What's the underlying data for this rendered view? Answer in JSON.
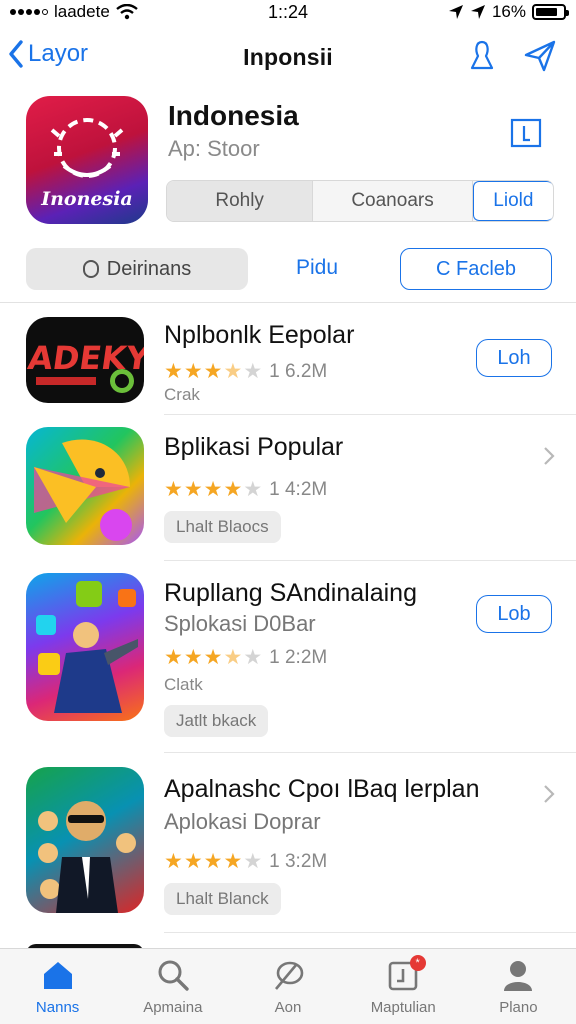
{
  "status_bar": {
    "carrier": "laadete",
    "time": "1::24",
    "battery": "16%",
    "battery_level": 0.8
  },
  "nav": {
    "back_label": "Layor",
    "title": "Inponsii",
    "icons": [
      "person-icon",
      "send-icon"
    ]
  },
  "app": {
    "name": "Indonesia",
    "subtitle": "Ap: Stoor",
    "icon_text": "Inonesia",
    "segments": [
      "Rohly",
      "Coanoars",
      "Liold"
    ],
    "accent_color": "#1a73e8"
  },
  "filters": {
    "pill_label": "Deirinans",
    "link_label": "Pidu",
    "button_label": "C Facleb"
  },
  "list": [
    {
      "title": "Nplbonlk Eepolar",
      "rating_text": "1 6.2M",
      "stars": 3.5,
      "small": "Crak",
      "button": "Loh",
      "icon_text": "ADEKY"
    },
    {
      "title": "Bplikasi Popular",
      "rating_text": "1 4:2M",
      "stars": 4,
      "tag": "Lhalt Blaocs"
    },
    {
      "title": "Rupllang SAndinalaing",
      "sub": "Splokasi D0Bar",
      "rating_text": "1 2:2M",
      "stars": 3.5,
      "small": "Clatk",
      "tag": "Jatlt bkack",
      "button": "Lob"
    },
    {
      "title": "Apalnashc Cpoı lBaq lerplan",
      "sub": "Aplokasi Doprar",
      "rating_text": "1 3:2M",
      "stars": 4,
      "tag": "Lhalt Blanck"
    }
  ],
  "tab_bar": [
    {
      "label": "Nanns",
      "icon": "home-icon",
      "active": true
    },
    {
      "label": "Apmaina",
      "icon": "search-icon",
      "active": false
    },
    {
      "label": "Aon",
      "icon": "leaf-icon",
      "active": false
    },
    {
      "label": "Maptulian",
      "icon": "updates-icon",
      "active": false,
      "badge": "*"
    },
    {
      "label": "Plano",
      "icon": "profile-icon",
      "active": false
    }
  ]
}
